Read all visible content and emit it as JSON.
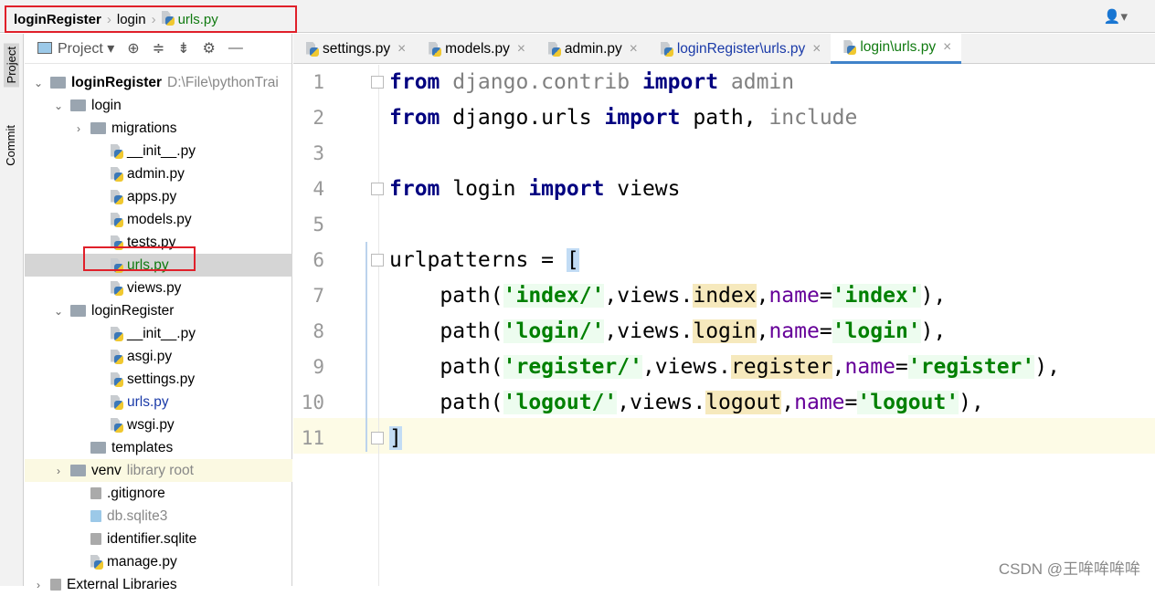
{
  "breadcrumb": [
    "loginRegister",
    "login",
    "urls.py"
  ],
  "project_panel": {
    "title": "Project",
    "side_tabs": [
      "Project",
      "Commit"
    ]
  },
  "tree": [
    {
      "label": "loginRegister",
      "hint": "D:\\File\\pythonTrai",
      "indent": 0,
      "type": "folder",
      "chev": "v",
      "bold": true
    },
    {
      "label": "login",
      "indent": 1,
      "type": "folder",
      "chev": "v"
    },
    {
      "label": "migrations",
      "indent": 2,
      "type": "folder",
      "chev": ">"
    },
    {
      "label": "__init__.py",
      "indent": 3,
      "type": "py"
    },
    {
      "label": "admin.py",
      "indent": 3,
      "type": "py"
    },
    {
      "label": "apps.py",
      "indent": 3,
      "type": "py"
    },
    {
      "label": "models.py",
      "indent": 3,
      "type": "py"
    },
    {
      "label": "tests.py",
      "indent": 3,
      "type": "py"
    },
    {
      "label": "urls.py",
      "indent": 3,
      "type": "py",
      "selected": true,
      "color": "#107a10"
    },
    {
      "label": "views.py",
      "indent": 3,
      "type": "py"
    },
    {
      "label": "loginRegister",
      "indent": 1,
      "type": "folder",
      "chev": "v"
    },
    {
      "label": "__init__.py",
      "indent": 3,
      "type": "py"
    },
    {
      "label": "asgi.py",
      "indent": 3,
      "type": "py"
    },
    {
      "label": "settings.py",
      "indent": 3,
      "type": "py"
    },
    {
      "label": "urls.py",
      "indent": 3,
      "type": "py",
      "color": "#1a3aa8"
    },
    {
      "label": "wsgi.py",
      "indent": 3,
      "type": "py"
    },
    {
      "label": "templates",
      "indent": 2,
      "type": "folder"
    },
    {
      "label": "venv",
      "hint": "library root",
      "indent": 1,
      "type": "folder",
      "chev": ">",
      "lib": true
    },
    {
      "label": ".gitignore",
      "indent": 2,
      "type": "file"
    },
    {
      "label": "db.sqlite3",
      "indent": 2,
      "type": "db",
      "color": "#888"
    },
    {
      "label": "identifier.sqlite",
      "indent": 2,
      "type": "file"
    },
    {
      "label": "manage.py",
      "indent": 2,
      "type": "py"
    },
    {
      "label": "External Libraries",
      "indent": 0,
      "type": "lib",
      "chev": ">"
    }
  ],
  "tabs": [
    {
      "label": "settings.py"
    },
    {
      "label": "models.py"
    },
    {
      "label": "admin.py"
    },
    {
      "label": "loginRegister\\urls.py",
      "color": "#1a3aa8"
    },
    {
      "label": "login\\urls.py",
      "color": "#107a10",
      "active": true
    }
  ],
  "code_lines": [
    [
      [
        "kw",
        "from"
      ],
      [
        "un",
        " django.contrib "
      ],
      [
        "kw",
        "import"
      ],
      [
        "un",
        " admin"
      ]
    ],
    [
      [
        "kw",
        "from"
      ],
      [
        "",
        ""
      ],
      [
        "",
        " django.urls "
      ],
      [
        "kw",
        "import"
      ],
      [
        "",
        " path, "
      ],
      [
        "un",
        "include"
      ]
    ],
    [],
    [
      [
        "kw",
        "from"
      ],
      [
        "",
        " login "
      ],
      [
        "kw",
        "import"
      ],
      [
        "",
        " views"
      ]
    ],
    [],
    [
      [
        "",
        "urlpatterns = "
      ],
      [
        "br",
        "["
      ]
    ],
    [
      [
        "",
        "    path("
      ],
      [
        "st",
        "'index/'"
      ],
      [
        "",
        ",views."
      ],
      [
        "hl",
        "index"
      ],
      [
        "",
        ","
      ],
      [
        "na",
        "name"
      ],
      [
        "",
        "="
      ],
      [
        "st",
        "'index'"
      ],
      [
        "",
        "),"
      ]
    ],
    [
      [
        "",
        "    path("
      ],
      [
        "st",
        "'login/'"
      ],
      [
        "",
        ",views."
      ],
      [
        "hl",
        "login"
      ],
      [
        "",
        ","
      ],
      [
        "na",
        "name"
      ],
      [
        "",
        "="
      ],
      [
        "st",
        "'login'"
      ],
      [
        "",
        "),"
      ]
    ],
    [
      [
        "",
        "    path("
      ],
      [
        "st",
        "'register/'"
      ],
      [
        "",
        ",views."
      ],
      [
        "hl",
        "register"
      ],
      [
        "",
        ","
      ],
      [
        "na",
        "name"
      ],
      [
        "",
        "="
      ],
      [
        "st",
        "'register'"
      ],
      [
        "",
        "),"
      ]
    ],
    [
      [
        "",
        "    path("
      ],
      [
        "st",
        "'logout/'"
      ],
      [
        "",
        ",views."
      ],
      [
        "hl",
        "logout"
      ],
      [
        "",
        ","
      ],
      [
        "na",
        "name"
      ],
      [
        "",
        "="
      ],
      [
        "st",
        "'logout'"
      ],
      [
        "",
        "),"
      ]
    ],
    [
      [
        "br",
        "]"
      ]
    ]
  ],
  "watermark": "CSDN @王哞哞哞哞"
}
